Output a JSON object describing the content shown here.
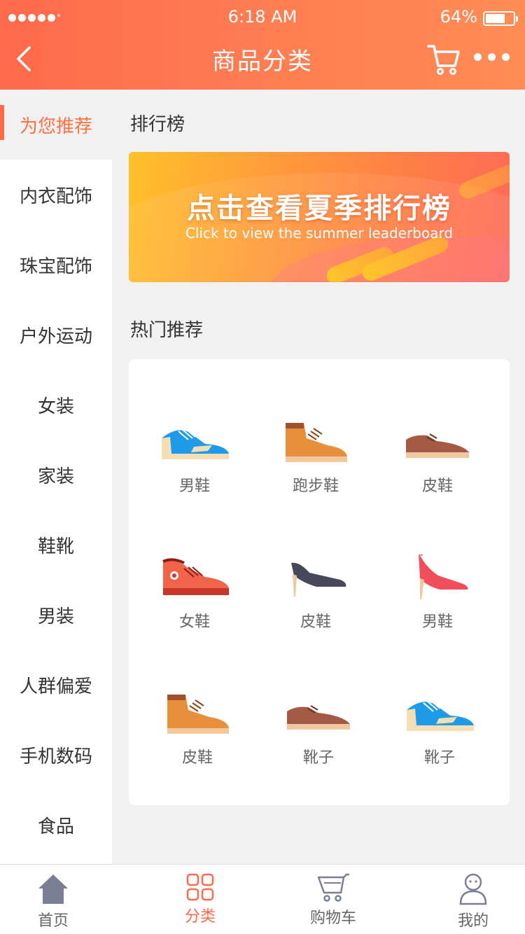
{
  "status_bar": {
    "time": "6:18 AM",
    "battery": "64%"
  },
  "nav": {
    "title": "商品分类"
  },
  "sidebar": {
    "items": [
      {
        "label": "为您推荐"
      },
      {
        "label": "内衣配饰"
      },
      {
        "label": "珠宝配饰"
      },
      {
        "label": "户外运动"
      },
      {
        "label": "女装"
      },
      {
        "label": "家装"
      },
      {
        "label": "鞋靴"
      },
      {
        "label": "男装"
      },
      {
        "label": "人群偏爱"
      },
      {
        "label": "手机数码"
      },
      {
        "label": "食品"
      }
    ]
  },
  "ranking": {
    "title": "排行榜",
    "banner_title": "点击查看夏季排行榜",
    "banner_subtitle": "Click to view the summer leaderboard"
  },
  "hot": {
    "title": "热门推荐",
    "items": [
      {
        "label": "男鞋",
        "icon": "blue-sneaker-icon"
      },
      {
        "label": "跑步鞋",
        "icon": "brown-boot-icon"
      },
      {
        "label": "皮鞋",
        "icon": "leather-shoe-icon"
      },
      {
        "label": "女鞋",
        "icon": "red-sneaker-icon"
      },
      {
        "label": "皮鞋",
        "icon": "dark-heel-icon"
      },
      {
        "label": "男鞋",
        "icon": "red-heel-icon"
      },
      {
        "label": "皮鞋",
        "icon": "brown-boot-icon"
      },
      {
        "label": "靴子",
        "icon": "leather-shoe-icon"
      },
      {
        "label": "靴子",
        "icon": "blue-sneaker-icon"
      }
    ]
  },
  "tabbar": {
    "items": [
      {
        "label": "首页",
        "icon": "home-icon"
      },
      {
        "label": "分类",
        "icon": "category-icon"
      },
      {
        "label": "购物车",
        "icon": "cart-icon"
      },
      {
        "label": "我的",
        "icon": "user-icon"
      }
    ]
  },
  "colors": {
    "accent": "#ff6a4a",
    "text": "#333333",
    "muted": "#666666"
  }
}
